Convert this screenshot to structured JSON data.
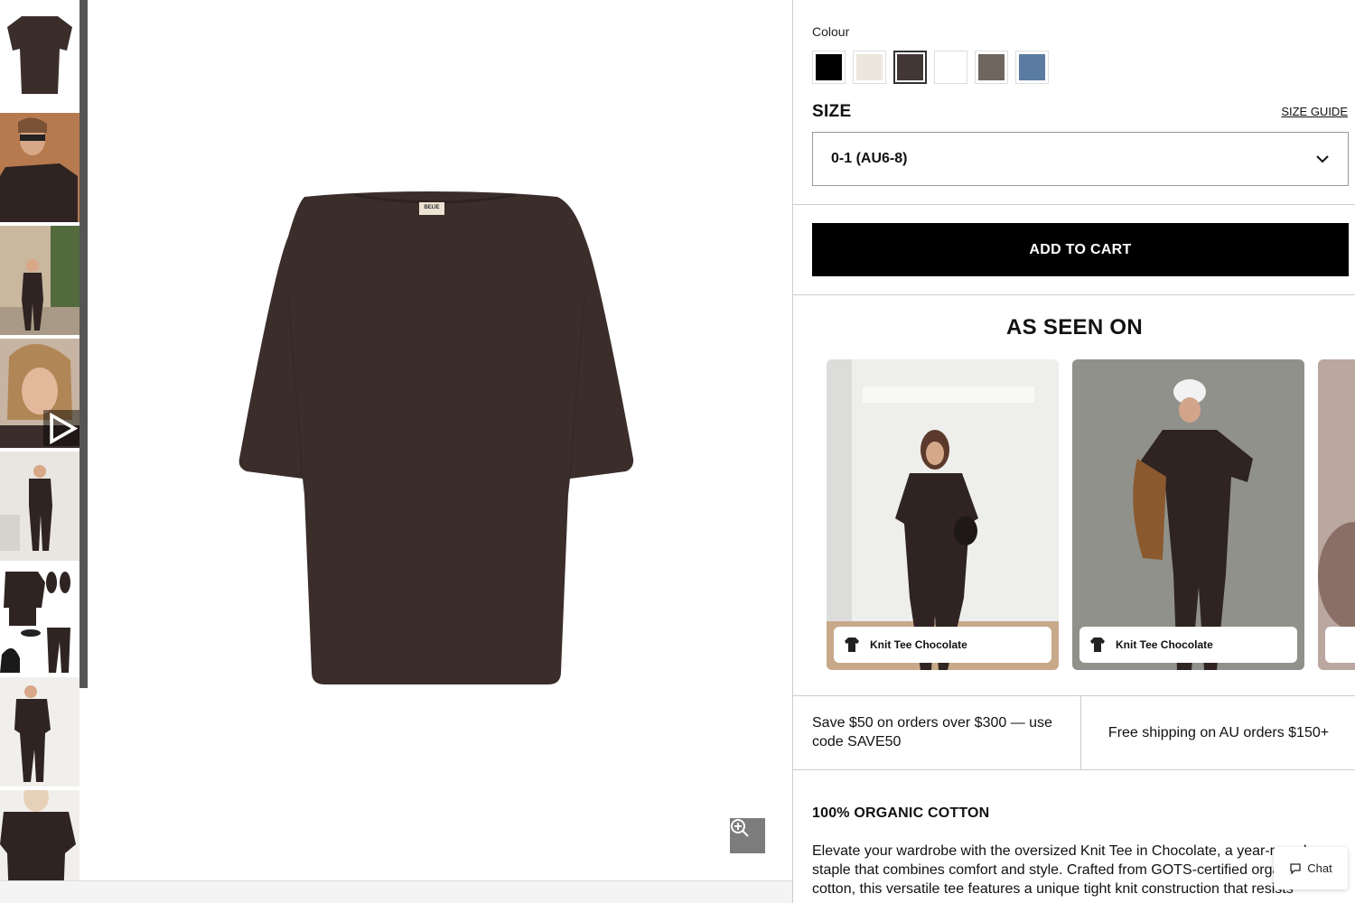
{
  "gallery": {
    "thumbnails": [
      {
        "alt": "product-flat"
      },
      {
        "alt": "model-closeup"
      },
      {
        "alt": "model-full-outdoor"
      },
      {
        "alt": "model-video",
        "is_video": true
      },
      {
        "alt": "model-standing"
      },
      {
        "alt": "flatlay-outfit"
      },
      {
        "alt": "model-full-white"
      },
      {
        "alt": "model-crop"
      }
    ],
    "play_icon": "play-icon",
    "zoom_icon": "zoom-in-icon",
    "brand_tag": "BEIJE"
  },
  "product": {
    "colour_label": "Colour",
    "colours": [
      {
        "name": "black",
        "hex": "#000000"
      },
      {
        "name": "cream",
        "hex": "#ece7dd"
      },
      {
        "name": "chocolate",
        "hex": "#433736",
        "selected": true
      },
      {
        "name": "white",
        "hex": "#ffffff"
      },
      {
        "name": "taupe",
        "hex": "#6f665f"
      },
      {
        "name": "blue",
        "hex": "#5a7ca3"
      }
    ],
    "size_label": "SIZE",
    "size_guide": "SIZE GUIDE",
    "size_selected": "0-1 (AU6-8)",
    "add_to_cart": "ADD TO CART"
  },
  "as_seen_on": {
    "title": "AS SEEN ON",
    "cards": [
      {
        "tag": "Knit Tee Chocolate"
      },
      {
        "tag": "Knit Tee Chocolate"
      }
    ]
  },
  "promos": {
    "left": "Save $50 on orders over $300 — use code SAVE50",
    "right": "Free shipping on AU orders $150+"
  },
  "details": {
    "title": "100% ORGANIC COTTON",
    "description": "Elevate your wardrobe with the oversized Knit Tee in Chocolate, a year-round staple that combines comfort and style. Crafted from GOTS-certified organic cotton, this versatile tee features a unique tight knit construction that resists"
  },
  "chat": {
    "label": "Chat",
    "icon": "chat-bubble-icon"
  },
  "colors": {
    "chocolate": "#3a2d2a",
    "button": "#000000"
  }
}
